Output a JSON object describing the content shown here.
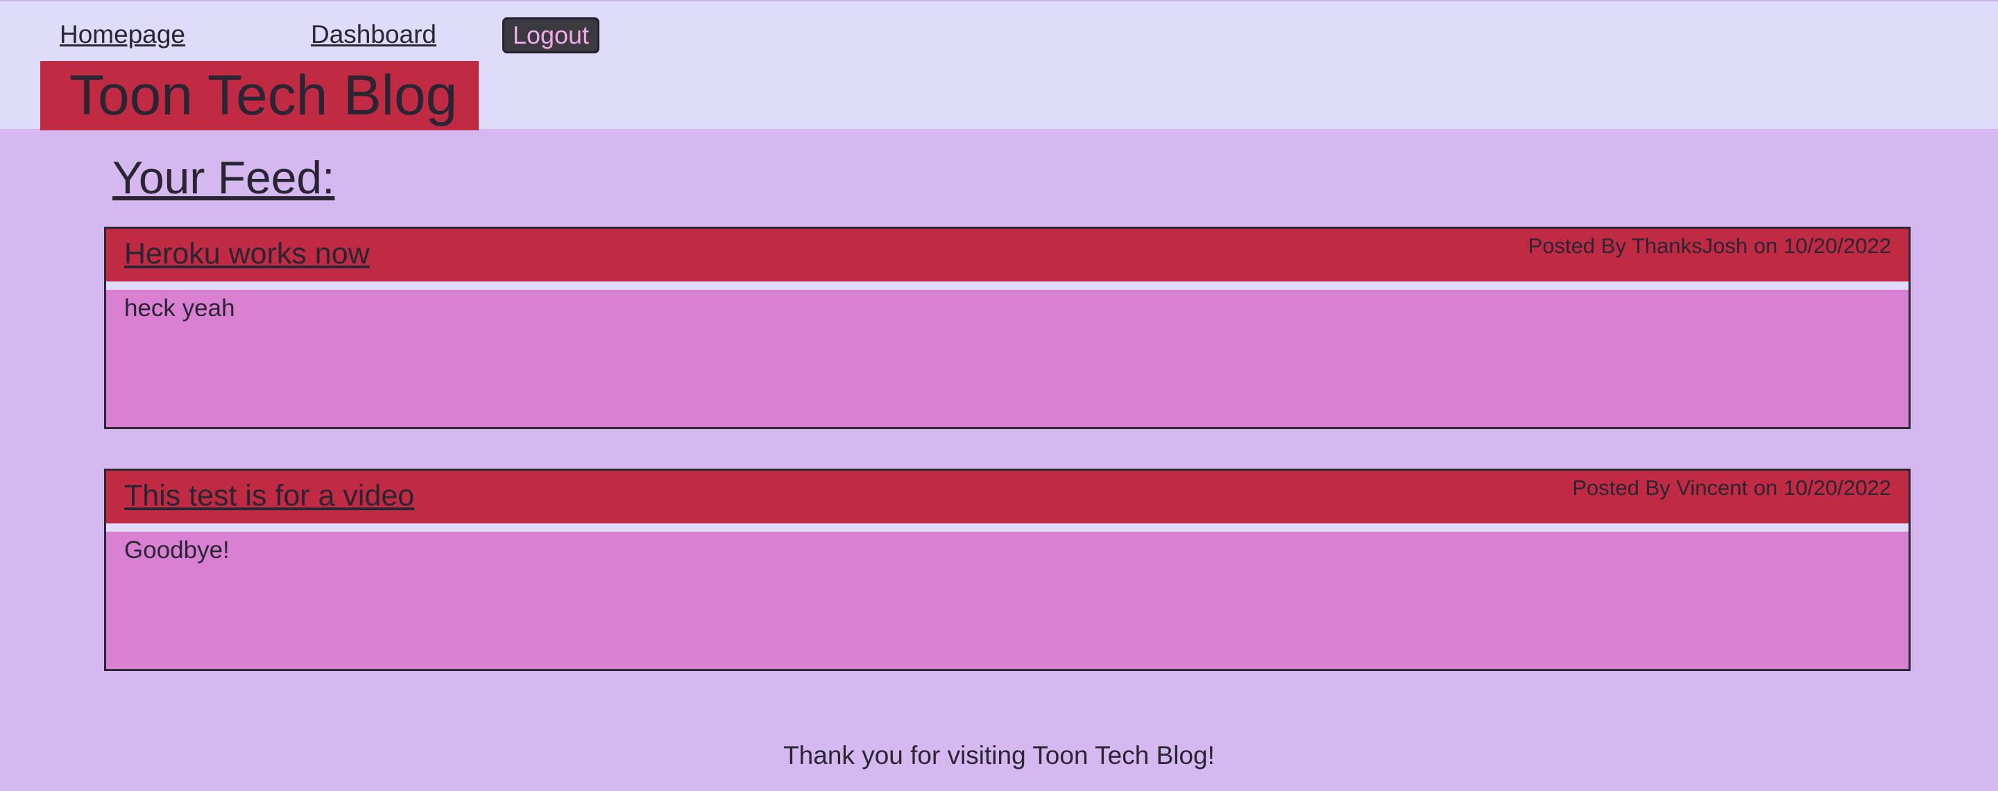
{
  "nav": {
    "homepage_label": "Homepage",
    "dashboard_label": "Dashboard",
    "logout_label": "Logout"
  },
  "brand": {
    "title": "Toon Tech Blog"
  },
  "feed": {
    "heading": "Your Feed:",
    "posts": [
      {
        "title": "Heroku works now",
        "meta": "Posted By ThanksJosh on 10/20/2022",
        "content": "heck yeah"
      },
      {
        "title": "This test is for a video",
        "meta": "Posted By Vincent on 10/20/2022",
        "content": "Goodbye!"
      }
    ]
  },
  "footer": {
    "text": "Thank you for visiting Toon Tech Blog!"
  },
  "colors": {
    "page_background": "#d5b8ef",
    "header_background": "#dedcf8",
    "accent_red": "#c02a42",
    "post_body_pink": "#da80d2",
    "logout_text_pink": "#f2a9ea",
    "text_dark": "#2a2533"
  }
}
